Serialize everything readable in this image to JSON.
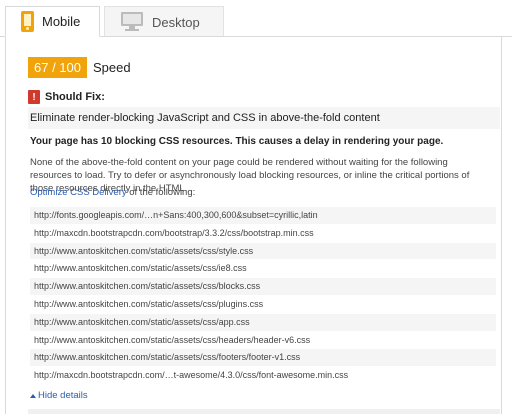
{
  "tabs": [
    {
      "label": "Mobile",
      "icon": "phone-icon",
      "active": true
    },
    {
      "label": "Desktop",
      "icon": "monitor-icon",
      "active": false
    }
  ],
  "score": {
    "value": "67 / 100",
    "label": "Speed",
    "color": "#f0a30a"
  },
  "should_fix": {
    "title": "Should Fix:",
    "icon": "alert-icon",
    "icon_glyph": "!",
    "color": "#d0392e"
  },
  "rule": {
    "title": "Eliminate render-blocking JavaScript and CSS in above-the-fold content",
    "summary": "Your page has 10 blocking CSS resources. This causes a delay in rendering your page.",
    "explanation": "None of the above-the-fold content on your page could be rendered without waiting for the following resources to load. Try to defer or asynchronously load blocking resources, or inline the critical portions of those resources directly in the HTML.",
    "delivery_link": "Optimize CSS Delivery",
    "delivery_suffix": " of the following:",
    "resources": [
      "http://fonts.googleapis.com/…n+Sans:400,300,600&subset=cyrillic,latin",
      "http://maxcdn.bootstrapcdn.com/bootstrap/3.3.2/css/bootstrap.min.css",
      "http://www.antoskitchen.com/static/assets/css/style.css",
      "http://www.antoskitchen.com/static/assets/css/ie8.css",
      "http://www.antoskitchen.com/static/assets/css/blocks.css",
      "http://www.antoskitchen.com/static/assets/css/plugins.css",
      "http://www.antoskitchen.com/static/assets/css/app.css",
      "http://www.antoskitchen.com/static/assets/css/headers/header-v6.css",
      "http://www.antoskitchen.com/static/assets/css/footers/footer-v1.css",
      "http://maxcdn.bootstrapcdn.com/…t-awesome/4.3.0/css/font-awesome.min.css"
    ],
    "hide_details": "Hide details"
  },
  "colors": {
    "link": "#2a5db0",
    "row_alt": "#f5f5f5"
  }
}
